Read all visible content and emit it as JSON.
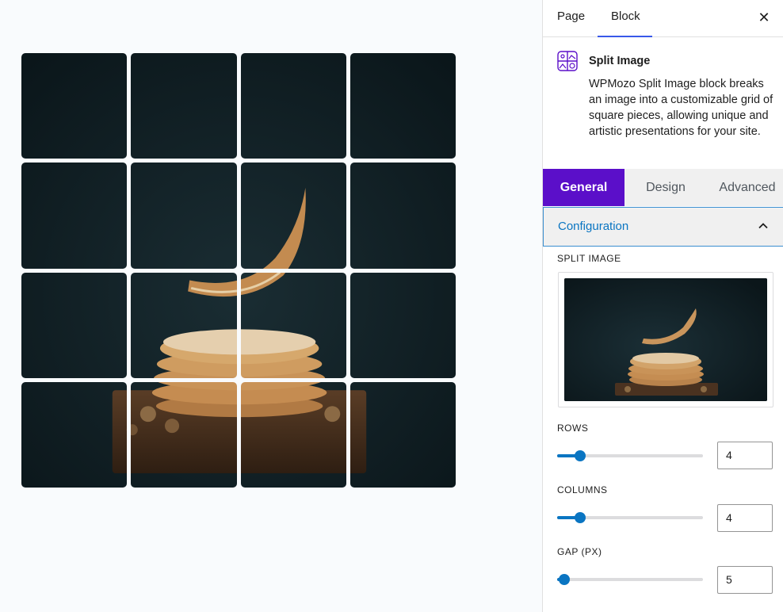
{
  "editor": {
    "top_tabs": [
      "Page",
      "Block"
    ],
    "active_top_tab": "Block",
    "close_glyph": "✕"
  },
  "block": {
    "icon": "split-image-icon",
    "title": "Split Image",
    "description": "WPMozo Split Image block breaks an image into a customizable grid of square pieces, allowing unique and artistic presentations for your site."
  },
  "settings_tabs": [
    {
      "label": "General",
      "active": true
    },
    {
      "label": "Design",
      "active": false
    },
    {
      "label": "Advanced",
      "active": false
    }
  ],
  "panel": {
    "title": "Configuration",
    "expanded": true,
    "split_image_label": "SPLIT IMAGE",
    "rows": {
      "label": "ROWS",
      "value": 4,
      "min": 1,
      "max": 20
    },
    "columns": {
      "label": "COLUMNS",
      "value": 4,
      "min": 1,
      "max": 20
    },
    "gap": {
      "label": "GAP (PX)",
      "value": 5,
      "min": 0,
      "max": 100
    }
  },
  "canvas": {
    "grid_rows": 4,
    "grid_cols": 4,
    "image_subject": "pancake stack with falling pancake on dark background"
  },
  "colors": {
    "accent": "#0a75c2",
    "active_tab_bg": "#5b0fc9",
    "image_bg": "#0f1d22"
  }
}
